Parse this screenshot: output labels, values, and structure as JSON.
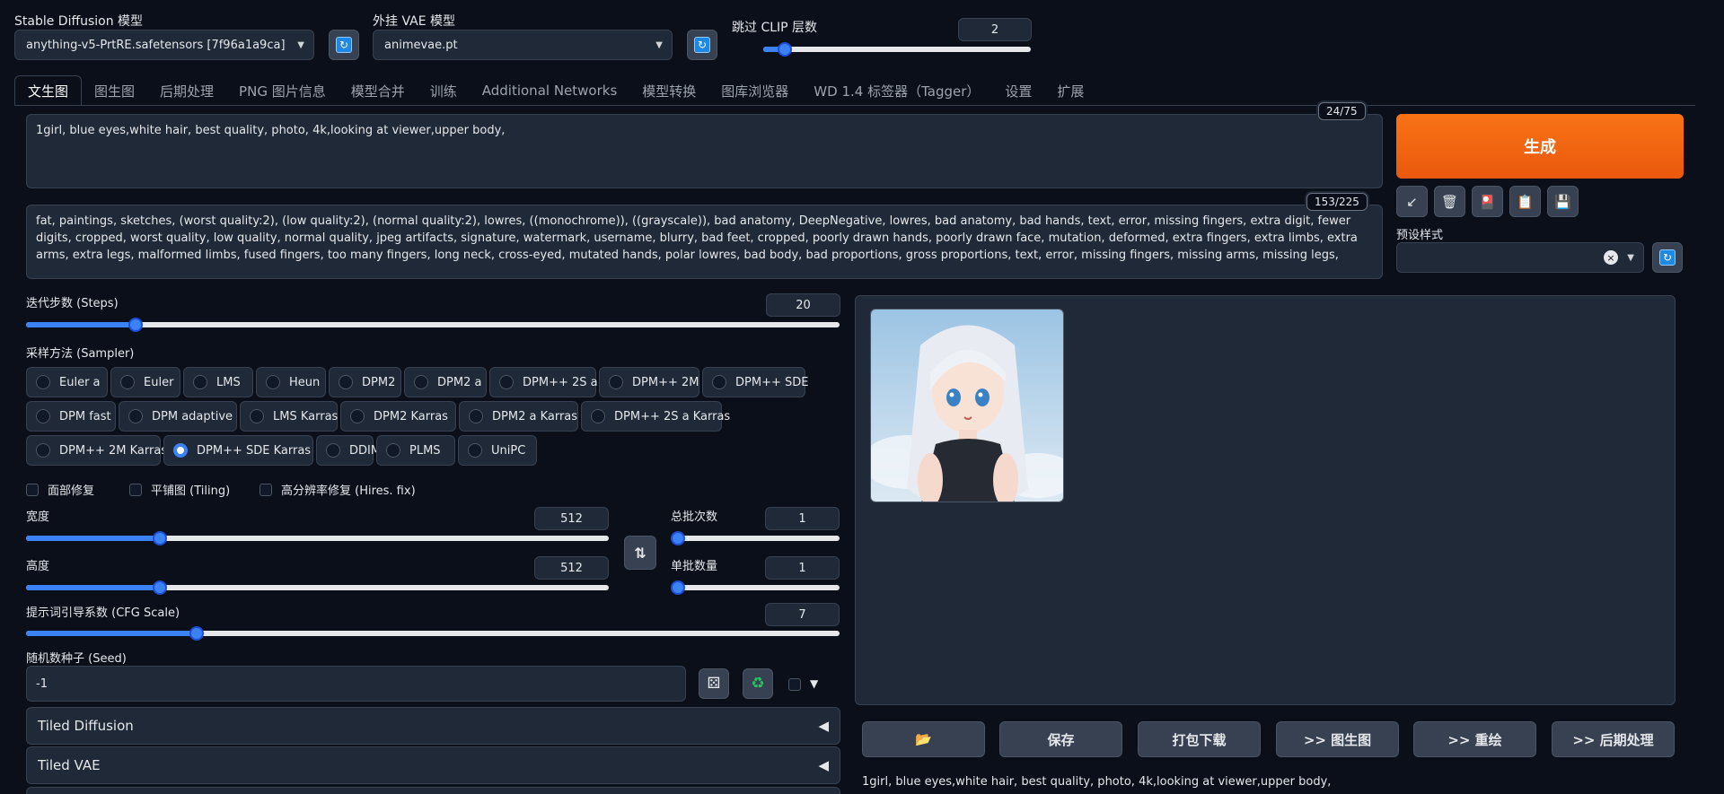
{
  "header": {
    "sd_model_label": "Stable Diffusion 模型",
    "sd_model_value": "anything-v5-PrtRE.safetensors [7f96a1a9ca]",
    "vae_label": "外挂 VAE 模型",
    "vae_value": "animevae.pt",
    "clip_label": "跳过 CLIP 层数",
    "clip_value": "2",
    "clip_level": 0.08
  },
  "tabs": [
    "文生图",
    "图生图",
    "后期处理",
    "PNG 图片信息",
    "模型合并",
    "训练",
    "Additional Networks",
    "模型转换",
    "图库浏览器",
    "WD 1.4 标签器（Tagger）",
    "设置",
    "扩展"
  ],
  "active_tab": 0,
  "prompt": {
    "text": "1girl, blue eyes,white hair, best quality, photo, 4k,looking at viewer,upper body,",
    "counter": "24/75"
  },
  "negative": {
    "text": "fat, paintings, sketches, (worst quality:2), (low quality:2), (normal quality:2), lowres, ((monochrome)), ((grayscale)), bad anatomy, DeepNegative, lowres, bad anatomy, bad hands, text, error, missing fingers, extra digit, fewer digits, cropped, worst quality, low quality, normal quality, jpeg artifacts, signature, watermark, username, blurry, bad feet, cropped, poorly drawn hands, poorly drawn face, mutation, deformed, extra fingers, extra limbs, extra arms, extra legs, malformed limbs, fused fingers, too many fingers, long neck, cross-eyed, mutated hands, polar lowres, bad body, bad proportions, gross proportions, text, error, missing fingers, missing arms, missing legs,",
    "counter": "153/225"
  },
  "actions": {
    "generate": "生成",
    "styles_label": "预设样式",
    "tool_icons": [
      "↙",
      "🗑",
      "🎴",
      "📋",
      "💾"
    ]
  },
  "params": {
    "steps_label": "迭代步数 (Steps)",
    "steps_value": "20",
    "steps_level": 0.135,
    "sampler_label": "采样方法 (Sampler)",
    "samplers_row1": [
      "Euler a",
      "Euler",
      "LMS",
      "Heun",
      "DPM2",
      "DPM2 a",
      "DPM++ 2S a",
      "DPM++ 2M",
      "DPM++ SDE"
    ],
    "samplers_row2": [
      "DPM fast",
      "DPM adaptive",
      "LMS Karras",
      "DPM2 Karras",
      "DPM2 a Karras",
      "DPM++ 2S a Karras"
    ],
    "samplers_row3": [
      "DPM++ 2M Karras",
      "DPM++ SDE Karras",
      "DDIM",
      "PLMS",
      "UniPC"
    ],
    "selected_sampler": "DPM++ SDE Karras",
    "restore_faces": "面部修复",
    "tiling": "平铺图 (Tiling)",
    "hires": "高分辨率修复 (Hires. fix)",
    "width_label": "宽度",
    "width_value": "512",
    "width_level": 0.23,
    "height_label": "高度",
    "height_value": "512",
    "height_level": 0.23,
    "batch_count_label": "总批次数",
    "batch_count_value": "1",
    "batch_count_level": 0,
    "batch_size_label": "单批数量",
    "batch_size_value": "1",
    "batch_size_level": 0,
    "cfg_label": "提示词引导系数 (CFG Scale)",
    "cfg_value": "7",
    "cfg_level": 0.21,
    "seed_label": "随机数种子 (Seed)",
    "seed_value": "-1",
    "accordion1": "Tiled Diffusion",
    "accordion2": "Tiled VAE"
  },
  "output": {
    "buttons": [
      "📂",
      "保存",
      "打包下载",
      ">> 图生图",
      ">> 重绘",
      ">> 后期处理"
    ],
    "info_text": "1girl, blue eyes,white hair, best quality, photo, 4k,looking at viewer,upper body,"
  },
  "colors": {
    "accent": "#3b82f6",
    "generate": "#f97316",
    "background": "#0b0f19",
    "panel": "#1f2937"
  }
}
